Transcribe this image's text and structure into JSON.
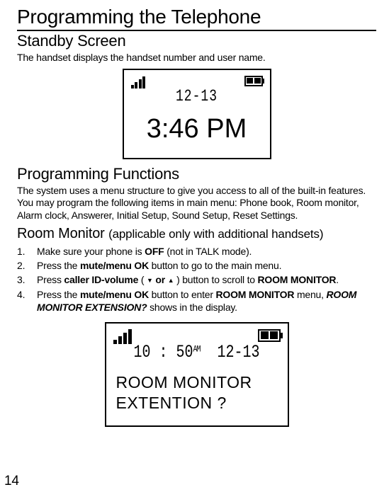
{
  "title": "Programming the Telephone",
  "standby": {
    "heading": "Standby Screen",
    "desc": "The handset displays the handset number and user name.",
    "screen": {
      "date": "12-13",
      "time": "3:46 PM"
    }
  },
  "progfunc": {
    "heading": "Programming Functions",
    "desc": "The system uses a menu structure to give you access to all of the built-in features. You may program the following items in main menu: Phone book, Room monitor, Alarm clock, Answerer, Initial Setup, Sound Setup, Reset Settings."
  },
  "roommon": {
    "heading": "Room Monitor ",
    "paren": "(applicable only with additional handsets)",
    "steps": [
      {
        "n": "1.",
        "pre": "Make sure your phone is ",
        "b1": "OFF",
        "post": " (not in TALK mode)."
      },
      {
        "n": "2.",
        "pre": "Press the ",
        "b1": "mute/menu OK",
        "post": " button to go to the main menu."
      },
      {
        "n": "3.",
        "pre": "Press ",
        "b1": "caller ID-volume",
        "mid1": " ( ",
        "tri_dn": "▼",
        "or": "  or  ",
        "tri_up": "▲",
        "mid2": " ) button to scroll to ",
        "b2": "ROOM MONITOR",
        "post": "."
      },
      {
        "n": "4.",
        "pre": "Press the ",
        "b1": "mute/menu OK",
        "mid1": " button to enter ",
        "b2": "ROOM MONITOR",
        "mid2": " menu, ",
        "bi": "ROOM MONITOR EXTENSION?",
        "post": " shows in the display."
      }
    ],
    "screen": {
      "time": "10 : 50",
      "ampm": "AM",
      "date": "12-13",
      "line1": "ROOM MONITOR",
      "line2": "EXTENTION ?"
    }
  },
  "page_num": "14"
}
